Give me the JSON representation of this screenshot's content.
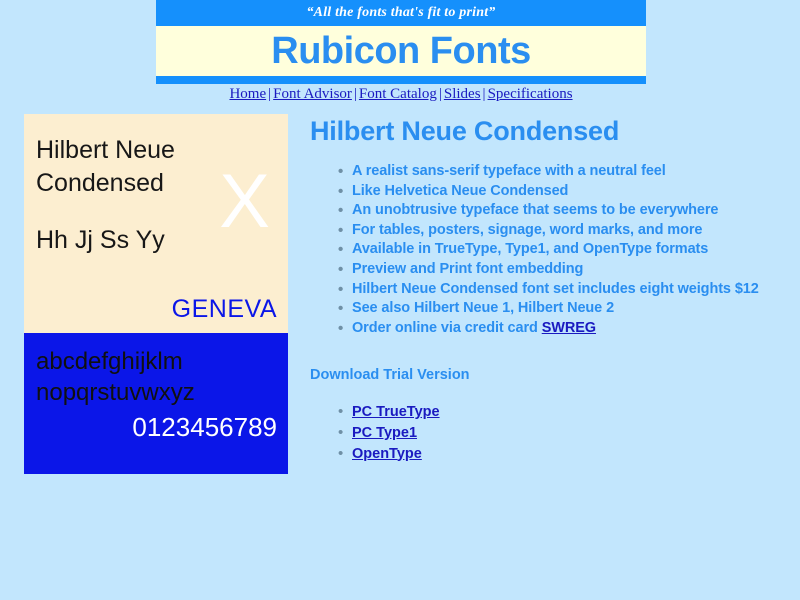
{
  "header": {
    "tagline": "“All the fonts that's fit to print”",
    "site_title": "Rubicon Fonts",
    "bar_color": "#1590fc",
    "band_color": "#ffffdc",
    "title_color": "#2a8ef0"
  },
  "nav": {
    "separator": "|",
    "items": [
      {
        "label": "Home"
      },
      {
        "label": "Font Advisor"
      },
      {
        "label": "Font Catalog"
      },
      {
        "label": "Slides"
      },
      {
        "label": "Specifications"
      }
    ]
  },
  "specimen": {
    "upper_bg": "#fceed0",
    "lower_bg": "#0b16e8",
    "name": "Hilbert Neue\nCondensed",
    "pairs": "Hh Jj Ss Yy",
    "sample_letter": "X",
    "foundry": "GENEVA",
    "alphabet": "abcdefghijklm\nnopqrstuvwxyz",
    "digits": "0123456789"
  },
  "main": {
    "heading": "Hilbert Neue Condensed",
    "features": [
      {
        "text": "A realist sans-serif typeface with a neutral feel",
        "link": ""
      },
      {
        "text": "Like Helvetica Neue Condensed",
        "link": ""
      },
      {
        "text": "An unobtrusive typeface that seems to be everywhere",
        "link": ""
      },
      {
        "text": "For tables, posters, signage, word marks, and more",
        "link": ""
      },
      {
        "text": "Available in TrueType, Type1, and OpenType formats",
        "link": ""
      },
      {
        "text": "Preview and Print font embedding",
        "link": ""
      },
      {
        "text": "Hilbert Neue Condensed font set includes eight weights $12",
        "link": ""
      },
      {
        "text": "See also Hilbert Neue 1, Hilbert Neue 2",
        "link": ""
      },
      {
        "text": "Order online via credit card ",
        "link": "SWREG"
      }
    ],
    "download_heading": "Download Trial Version",
    "downloads": [
      {
        "label": "PC TrueType"
      },
      {
        "label": "PC Type1"
      },
      {
        "label": "OpenType"
      }
    ]
  }
}
